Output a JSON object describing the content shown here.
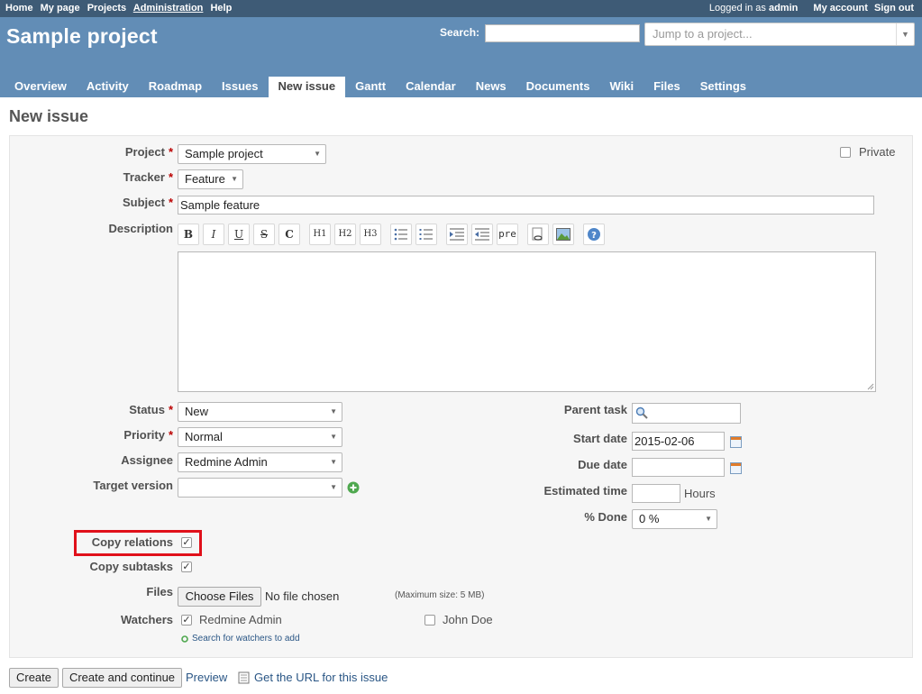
{
  "top_menu": {
    "left_items": [
      "Home",
      "My page",
      "Projects",
      "Administration",
      "Help"
    ],
    "logged_in_prefix": "Logged in as",
    "logged_in_user": "admin",
    "my_account": "My account",
    "sign_out": "Sign out"
  },
  "header": {
    "project_title": "Sample project",
    "search_label": "Search:",
    "search_value": "",
    "jump_placeholder": "Jump to a project..."
  },
  "main_menu": {
    "tabs": [
      "Overview",
      "Activity",
      "Roadmap",
      "Issues",
      "New issue",
      "Gantt",
      "Calendar",
      "News",
      "Documents",
      "Wiki",
      "Files",
      "Settings"
    ],
    "selected": "New issue"
  },
  "page_title": "New issue",
  "form": {
    "project_label": "Project",
    "project_value": "Sample project",
    "private_label": "Private",
    "tracker_label": "Tracker",
    "tracker_value": "Feature",
    "subject_label": "Subject",
    "subject_value": "Sample feature",
    "description_label": "Description",
    "toolbar": {
      "bold": "B",
      "italic": "I",
      "underline": "U",
      "strike": "S",
      "code": "C",
      "h1": "H1",
      "h2": "H2",
      "h3": "H3",
      "pre": "pre"
    },
    "status_label": "Status",
    "status_value": "New",
    "priority_label": "Priority",
    "priority_value": "Normal",
    "assignee_label": "Assignee",
    "assignee_value": "Redmine Admin",
    "target_version_label": "Target version",
    "target_version_value": "",
    "parent_task_label": "Parent task",
    "start_date_label": "Start date",
    "start_date_value": "2015-02-06",
    "due_date_label": "Due date",
    "due_date_value": "",
    "estimated_time_label": "Estimated time",
    "estimated_time_value": "",
    "hours_label": "Hours",
    "done_label": "% Done",
    "done_value": "0 %",
    "copy_relations_label": "Copy relations",
    "copy_subtasks_label": "Copy subtasks",
    "files_label": "Files",
    "choose_files": "Choose Files",
    "no_file": "No file chosen",
    "max_size": "(Maximum size: 5 MB)",
    "watchers_label": "Watchers",
    "watchers": [
      "Redmine Admin",
      "John Doe"
    ],
    "search_watchers": "Search for watchers to add"
  },
  "actions": {
    "create": "Create",
    "create_continue": "Create and continue",
    "preview": "Preview",
    "get_url": "Get the URL for this issue"
  },
  "colors": {
    "top_bar": "#3e5b76",
    "header": "#628db6",
    "highlight": "#e0101a",
    "required": "#bb0000",
    "link": "#2a5685"
  }
}
